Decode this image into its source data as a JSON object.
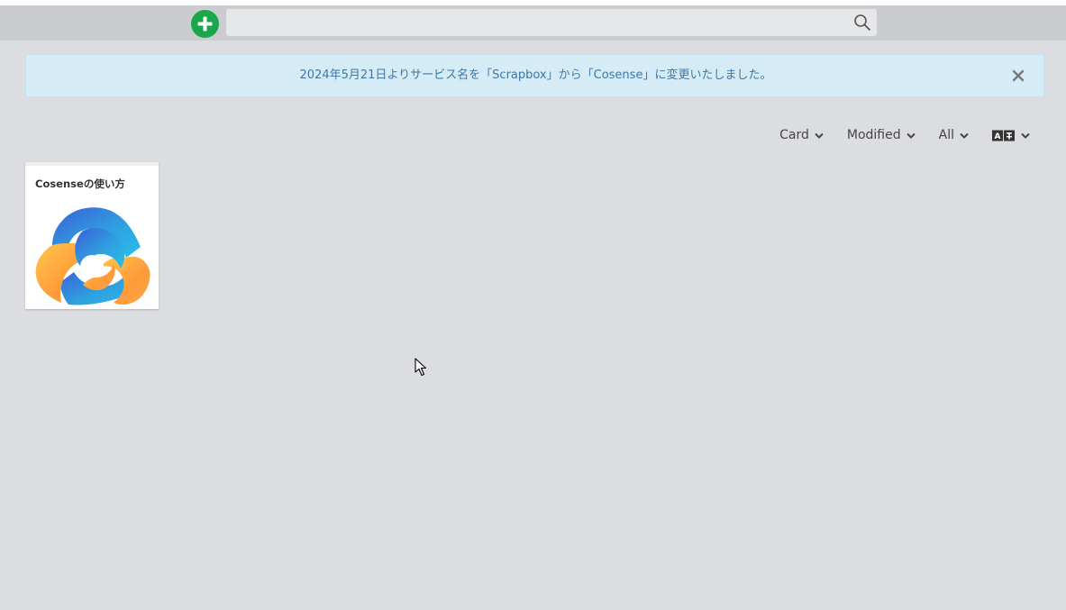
{
  "navbar": {
    "add_label": "+",
    "search": {
      "value": "",
      "placeholder": ""
    }
  },
  "alert": {
    "message": "2024年5月21日よりサービス名を「Scrapbox」から「Cosense」に変更いたしました。",
    "close_label": "×"
  },
  "toolbar": {
    "view_label": "Card",
    "sort_label": "Modified",
    "filter_label": "All",
    "lang_icon": "translate-icon"
  },
  "pages": [
    {
      "title": "Cosenseの使い方",
      "thumbnail": "cosense-logo"
    }
  ],
  "colors": {
    "accent_green": "#1aa64b",
    "alert_bg": "#d5ebf5",
    "alert_text": "#3f77a8"
  }
}
